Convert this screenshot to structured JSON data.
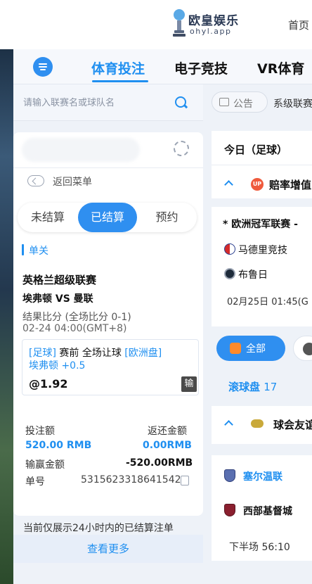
{
  "header": {
    "brand_name": "欧皇娱乐",
    "brand_domain": "ohyl.app",
    "home_link": "首页"
  },
  "nav": {
    "tabs": [
      {
        "label": "体育投注",
        "active": true
      },
      {
        "label": "电子竞技",
        "active": false
      },
      {
        "label": "VR体育",
        "active": false
      }
    ]
  },
  "search": {
    "placeholder": "请输入联赛名或球队名"
  },
  "bet_panel": {
    "back_label": "返回菜单",
    "tabs": [
      {
        "label": "未结算",
        "active": false
      },
      {
        "label": "已结算",
        "active": true
      },
      {
        "label": "预约",
        "active": false
      }
    ],
    "section_label": "单关",
    "bet": {
      "league": "英格兰超级联赛",
      "matchup": "埃弗顿 VS 曼联",
      "result": "结果比分 (全场比分 0-1)",
      "time": "02-24 04:00(GMT+8)",
      "sport_tag": "[足球]",
      "market": "赛前 全场让球",
      "odds_type": "[欧洲盘]",
      "selection": "埃弗顿 +0.5",
      "odds": "@1.92",
      "outcome": "输",
      "stake_label": "投注额",
      "stake_value": "520.00 RMB",
      "return_label": "返还金额",
      "return_value": "0.00RMB",
      "winloss_label": "输赢金额",
      "winloss_value": "-520.00RMB",
      "ticket_label": "单号",
      "ticket_value": "5315623318641542"
    },
    "footer_note": "当前仅展示24小时内的已结算注单",
    "see_more": "查看更多"
  },
  "right_panel": {
    "notice_label": "公告",
    "marquee_text": "系级联赛",
    "today_title": "今日（足球）",
    "boost_badge": "UP",
    "boost_label": "赔率增值",
    "match": {
      "league": "* 欧洲冠军联赛 -",
      "home": "马德里竞技",
      "away": "布鲁日",
      "kickoff": "02月25日 01:45(G"
    },
    "filter_all": "全部",
    "live_label": "滚球盘",
    "live_count": "17",
    "friendly_label": "球会友谊",
    "live_match": {
      "home": "塞尔温联",
      "away": "西部基督城",
      "period": "下半场",
      "clock": "56:10"
    }
  },
  "colors": {
    "accent": "#1f8ff0",
    "up_badge": "#ef5a3c",
    "lose_badge": "#4a4a4a"
  }
}
